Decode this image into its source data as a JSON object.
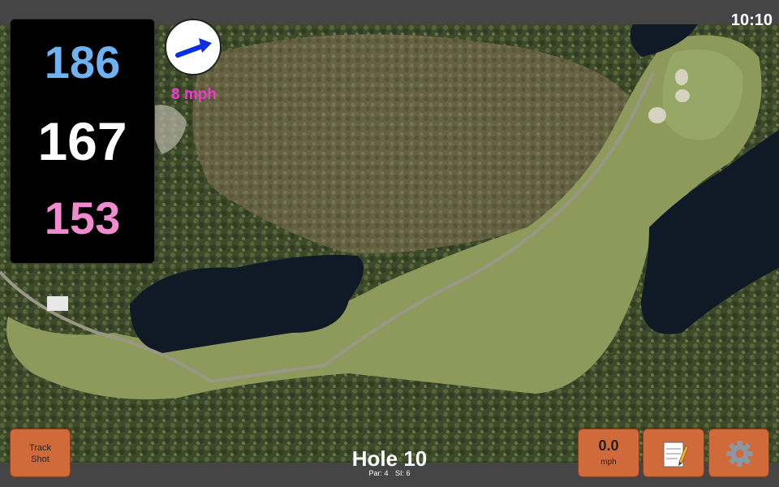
{
  "clock": "10:10",
  "distances": {
    "back": "186",
    "middle": "167",
    "front": "153"
  },
  "wind": {
    "speed": "8 mph",
    "icon": "arrow-right-icon",
    "arrow_color": "#0a2ee0"
  },
  "buttons": {
    "track_shot": {
      "line1": "Track",
      "line2": "Shot"
    },
    "speed": {
      "value": "0.0",
      "unit": "mph"
    },
    "notes_icon": "notepad-icon",
    "settings_icon": "gear-icon"
  },
  "hole": {
    "title": "Hole 10",
    "par": "Par: 4",
    "si": "SI: 6"
  },
  "colors": {
    "button": "#d06a3a",
    "back": "#6fb2f2",
    "middle": "#ffffff",
    "front": "#f08bd0",
    "wind_text": "#e93fc8"
  }
}
